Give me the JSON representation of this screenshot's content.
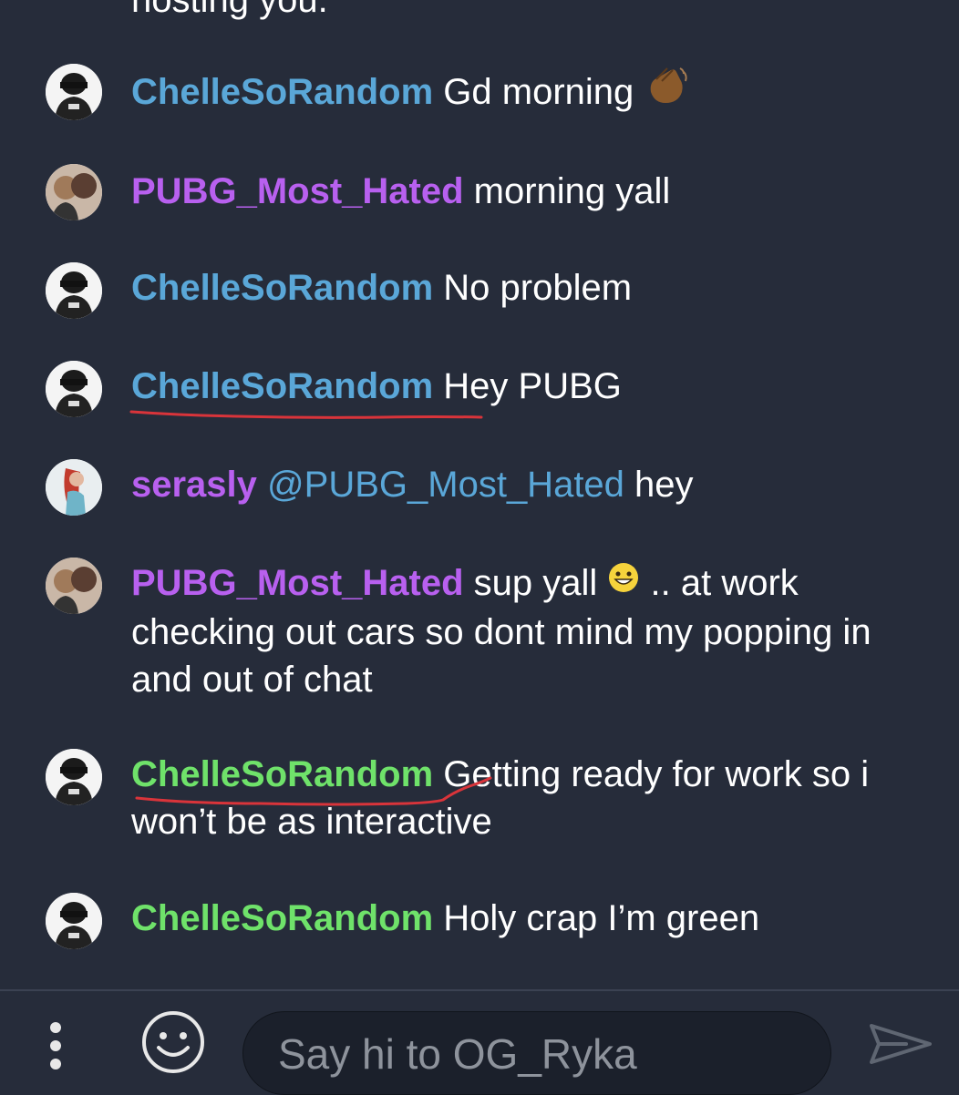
{
  "chat": {
    "partial_text": "hosting you.",
    "messages": [
      {
        "user": "ChelleSoRandom",
        "text": "Gd morning",
        "emoji": "👋🏾"
      },
      {
        "user": "PUBG_Most_Hated",
        "text": "morning yall"
      },
      {
        "user": "ChelleSoRandom",
        "text": "No problem"
      },
      {
        "user": "ChelleSoRandom",
        "text": "Hey PUBG"
      },
      {
        "user": "serasly",
        "mention": "@PUBG_Most_Hated",
        "text": " hey"
      },
      {
        "user": "PUBG_Most_Hated",
        "text_a": "sup yall",
        "emoji": "😀",
        "text_b": ".. at work checking out cars so dont mind my popping in and out of chat"
      },
      {
        "user": "ChelleSoRandom",
        "text": "Getting ready for work so i won’t be as interactive"
      },
      {
        "user": "ChelleSoRandom",
        "text": "Holy crap I’m green"
      }
    ]
  },
  "colors": {
    "background": "#262c3a",
    "username_blue": "#5aa7d8",
    "username_purple": "#b860ef",
    "username_green": "#6fe26a",
    "annotation_red": "#d9343a"
  },
  "composer": {
    "placeholder": "Say hi to OG_Ryka",
    "icons": [
      "more-vertical-icon",
      "emoji-smiley-icon",
      "send-icon"
    ]
  }
}
